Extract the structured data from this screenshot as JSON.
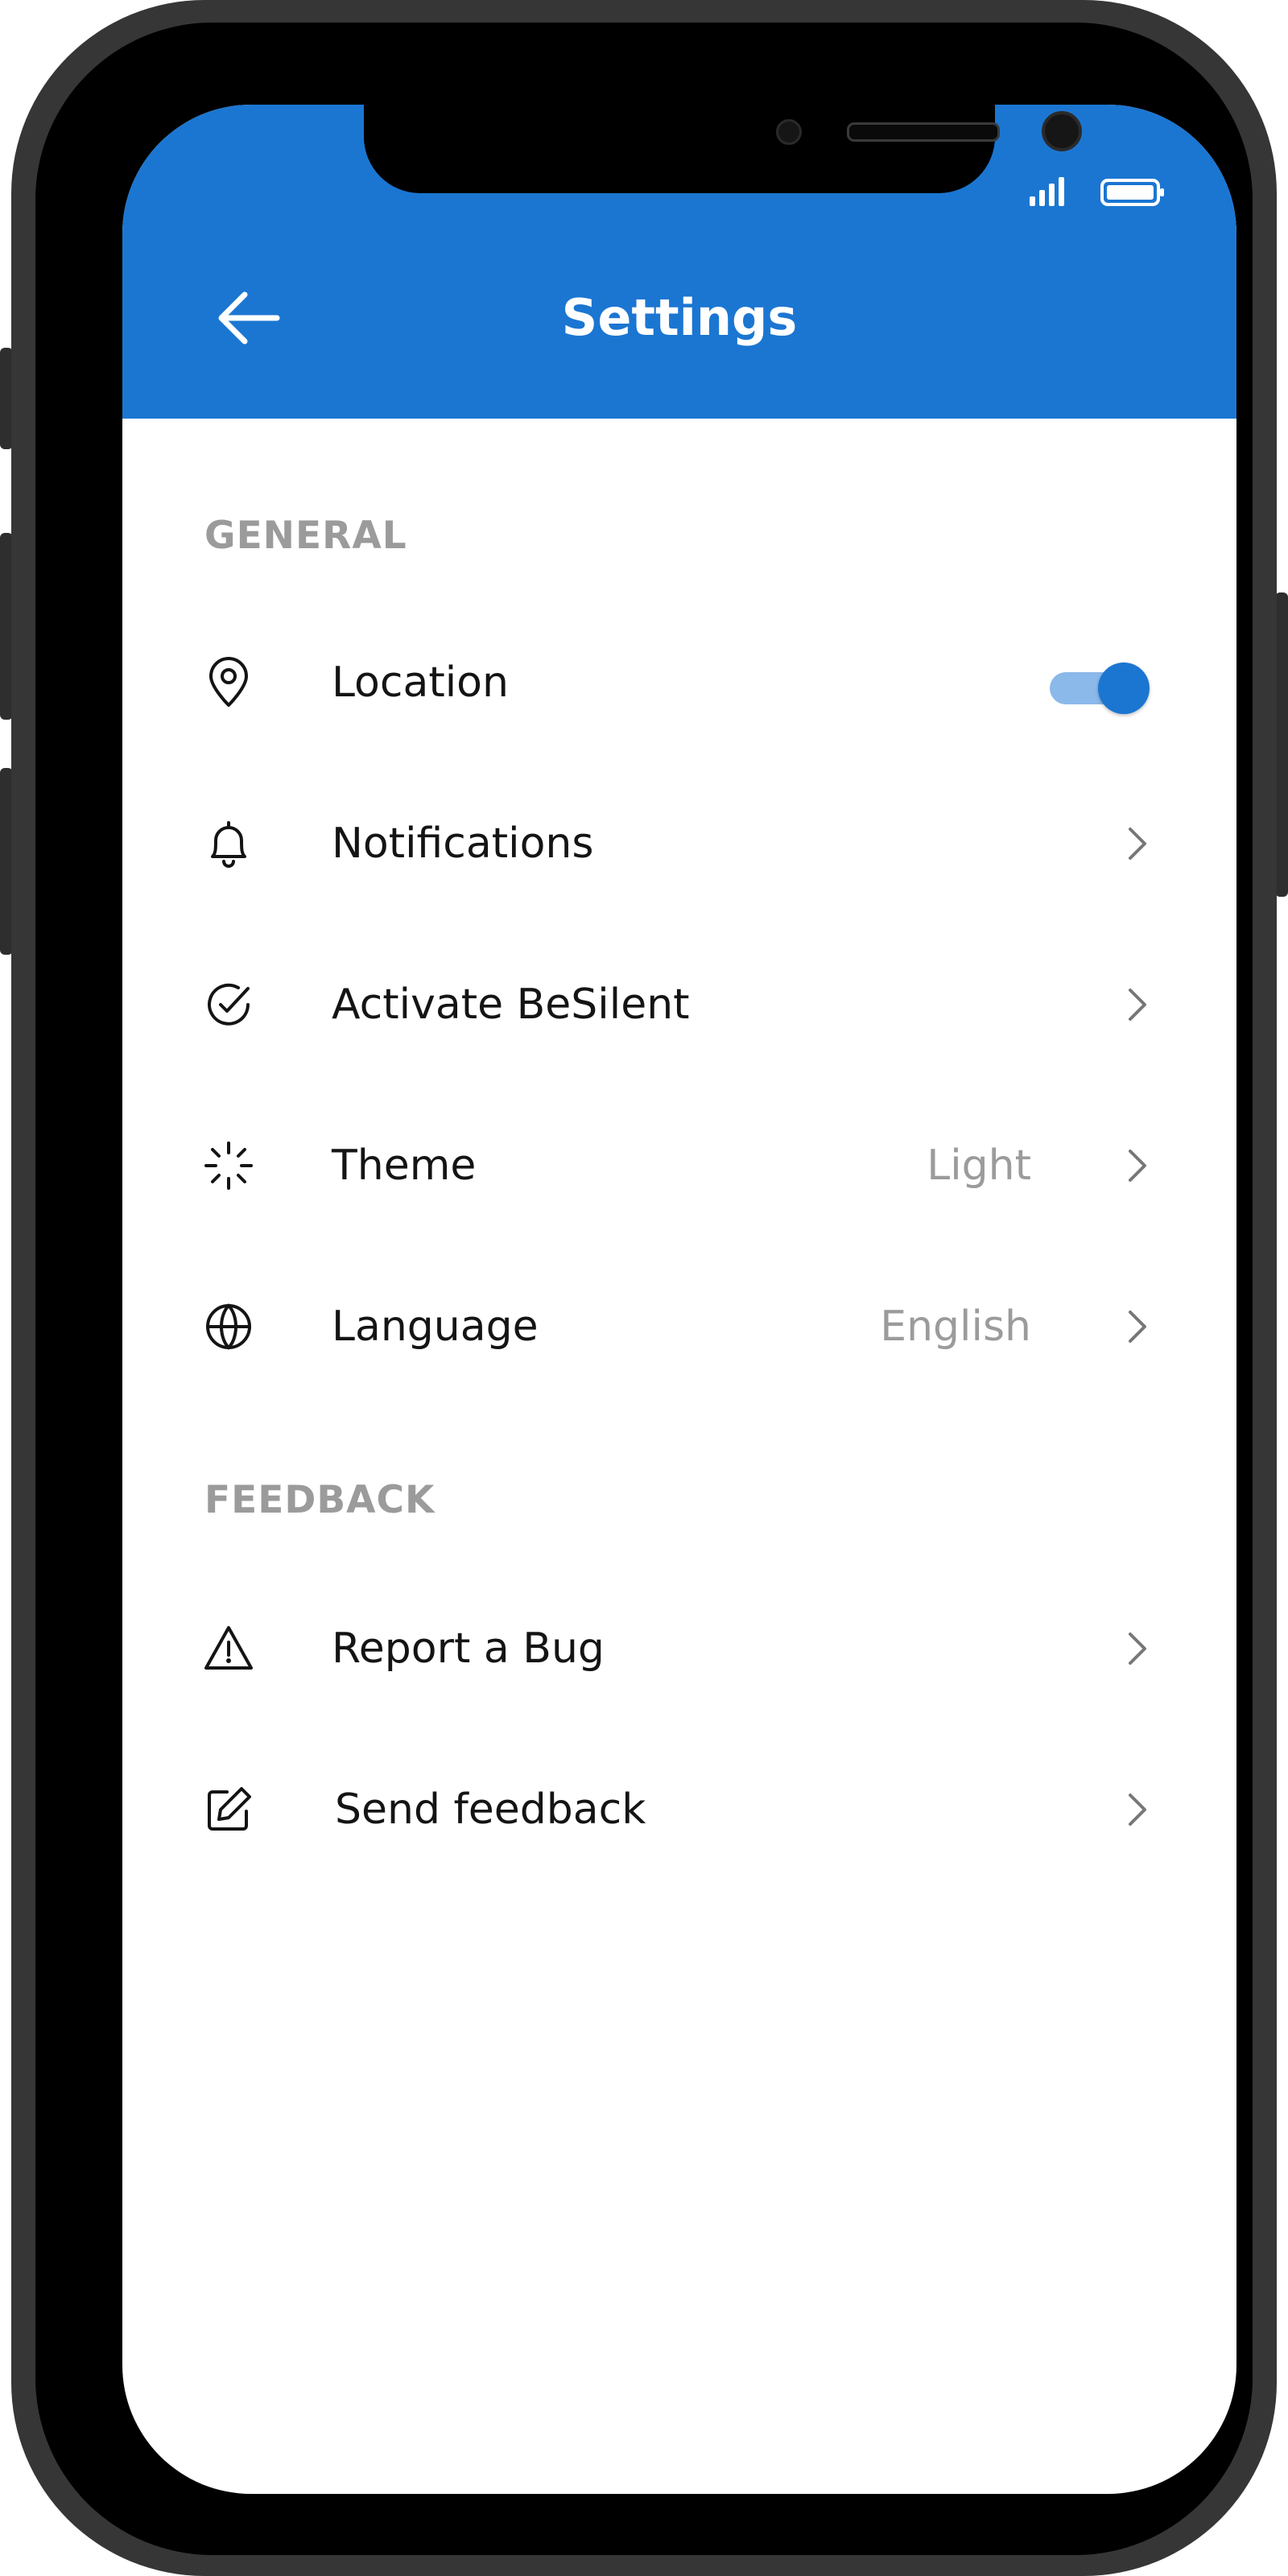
{
  "status_bar": {
    "signal_icon": "signal-icon",
    "battery_icon": "battery-icon"
  },
  "header": {
    "title": "Settings",
    "back_icon": "arrow-left-icon",
    "background": "#1b76d2"
  },
  "sections": {
    "general": {
      "title": "GENERAL",
      "items": [
        {
          "label": "Location",
          "icon": "map-pin-icon",
          "control": "toggle",
          "toggle_on": true
        },
        {
          "label": "Notifications",
          "icon": "bell-icon",
          "control": "chevron"
        },
        {
          "label": "Activate BeSilent",
          "icon": "check-circle-icon",
          "control": "chevron"
        },
        {
          "label": "Theme",
          "icon": "loader-icon",
          "value": "Light",
          "control": "chevron"
        },
        {
          "label": "Language",
          "icon": "globe-icon",
          "value": "English",
          "control": "chevron"
        }
      ]
    },
    "feedback": {
      "title": "FEEDBACK",
      "items": [
        {
          "label": "Report a Bug",
          "icon": "alert-triangle-icon",
          "control": "chevron"
        },
        {
          "label": "Send feedback",
          "icon": "edit-icon",
          "control": "chevron"
        }
      ]
    }
  },
  "colors": {
    "accent": "#1b76d2",
    "toggle_track": "#8bb9ea",
    "secondary_text": "#9b9b9b"
  }
}
